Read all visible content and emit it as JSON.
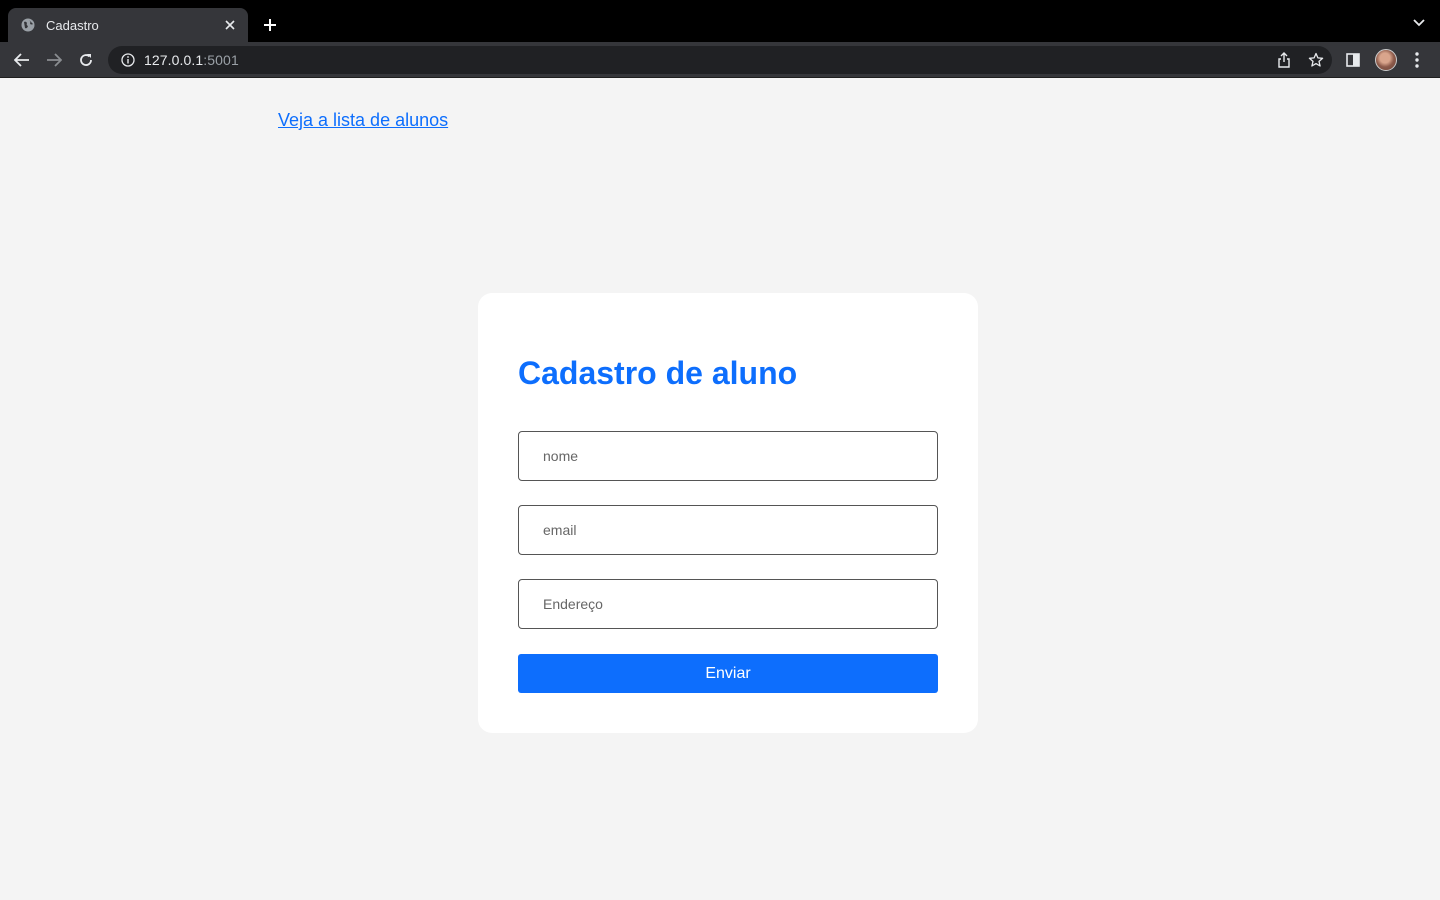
{
  "browser": {
    "tab_title": "Cadastro",
    "url_host": "127.0.0.1",
    "url_port": ":5001"
  },
  "page": {
    "list_link": "Veja a lista de alunos",
    "form": {
      "title": "Cadastro de aluno",
      "fields": [
        {
          "placeholder": "nome",
          "value": ""
        },
        {
          "placeholder": "email",
          "value": ""
        },
        {
          "placeholder": "Endereço",
          "value": ""
        }
      ],
      "submit_label": "Enviar"
    }
  },
  "colors": {
    "accent": "#0d6efd",
    "page_bg": "#f4f4f4",
    "card_bg": "#ffffff"
  },
  "icons": [
    "globe-icon",
    "close-icon",
    "plus-icon",
    "chevron-down-icon",
    "back-arrow-icon",
    "forward-arrow-icon",
    "reload-icon",
    "info-icon",
    "share-icon",
    "star-icon",
    "side-panel-icon",
    "kebab-menu-icon"
  ]
}
